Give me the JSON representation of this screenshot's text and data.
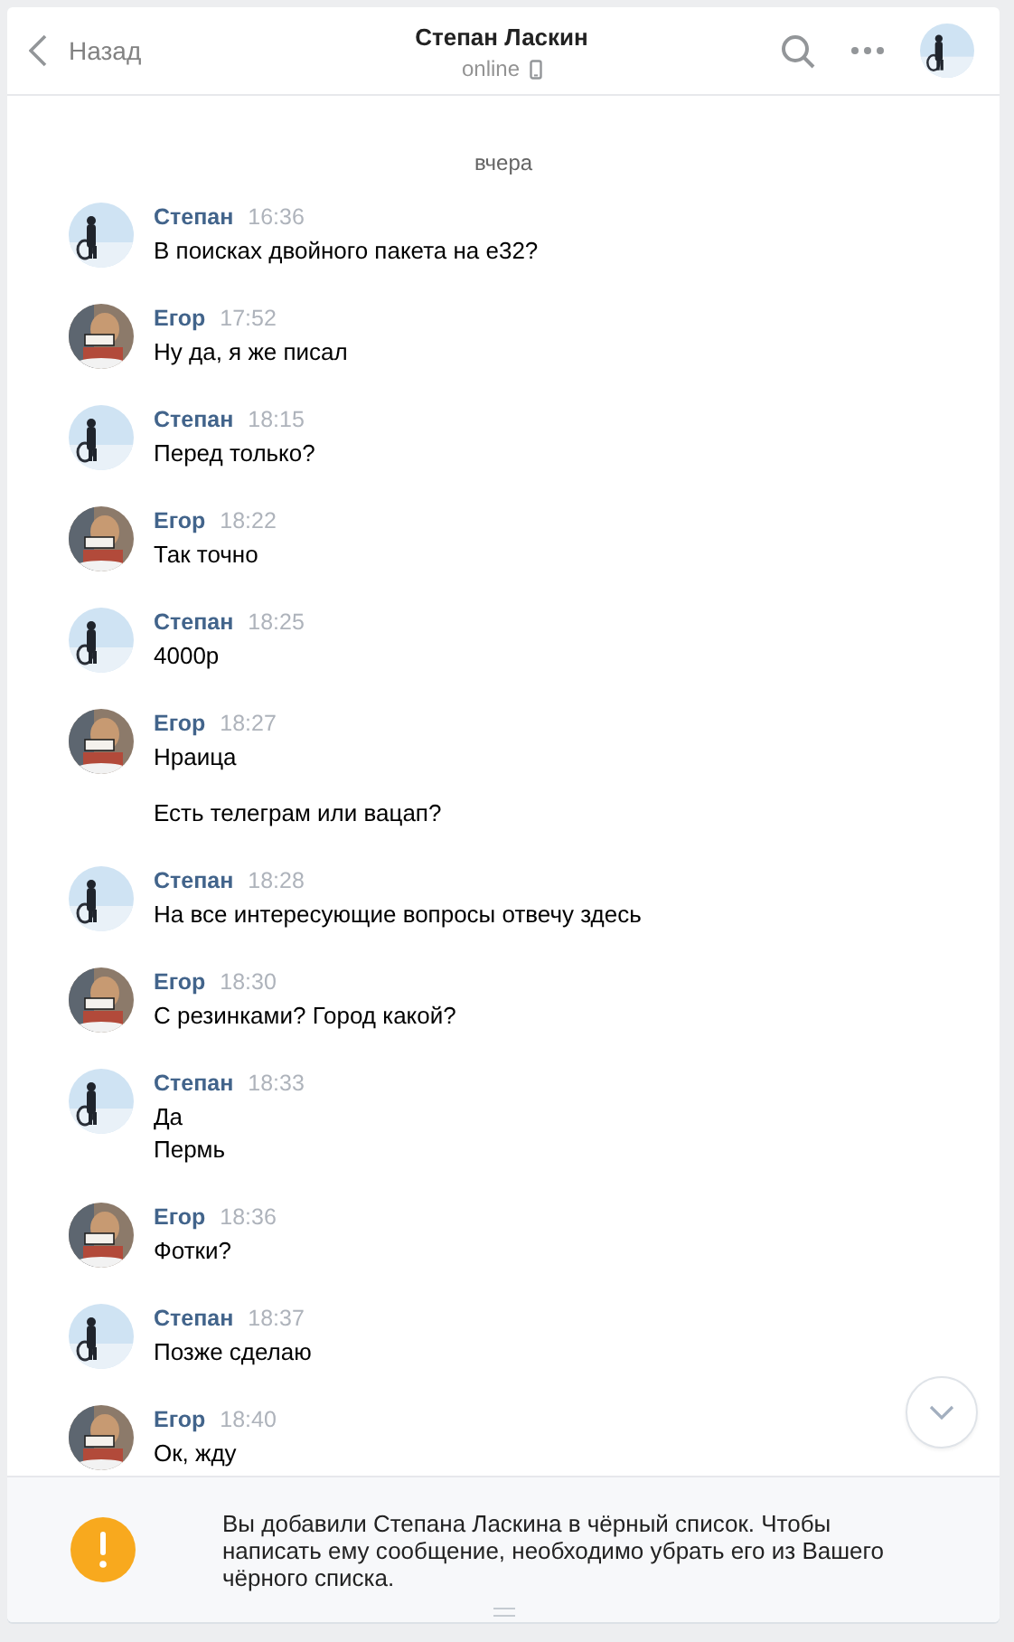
{
  "header": {
    "back_label": "Назад",
    "title": "Степан Ласкин",
    "status": "online"
  },
  "date_divider": "вчера",
  "messages": [
    {
      "author": "Степан",
      "time": "16:36",
      "messages": [
        {
          "lines": [
            "В поисках двойного пакета на е32?"
          ]
        }
      ]
    },
    {
      "author": "Егор",
      "time": "17:52",
      "messages": [
        {
          "lines": [
            "Ну да, я же писал"
          ]
        }
      ]
    },
    {
      "author": "Степан",
      "time": "18:15",
      "messages": [
        {
          "lines": [
            "Перед только?"
          ]
        }
      ]
    },
    {
      "author": "Егор",
      "time": "18:22",
      "messages": [
        {
          "lines": [
            "Так точно"
          ]
        }
      ]
    },
    {
      "author": "Степан",
      "time": "18:25",
      "messages": [
        {
          "lines": [
            "4000р"
          ]
        }
      ]
    },
    {
      "author": "Егор",
      "time": "18:27",
      "messages": [
        {
          "lines": [
            "Нраица"
          ]
        },
        {
          "lines": [
            "Есть телеграм или вацап?"
          ]
        }
      ]
    },
    {
      "author": "Степан",
      "time": "18:28",
      "messages": [
        {
          "lines": [
            "На все интересующие вопросы отвечу здесь"
          ]
        }
      ]
    },
    {
      "author": "Егор",
      "time": "18:30",
      "messages": [
        {
          "lines": [
            "С резинками? Город какой?"
          ]
        }
      ]
    },
    {
      "author": "Степан",
      "time": "18:33",
      "messages": [
        {
          "lines": [
            "Да",
            "Пермь"
          ]
        }
      ]
    },
    {
      "author": "Егор",
      "time": "18:36",
      "messages": [
        {
          "lines": [
            "Фотки?"
          ]
        }
      ]
    },
    {
      "author": "Степан",
      "time": "18:37",
      "messages": [
        {
          "lines": [
            "Позже сделаю"
          ]
        }
      ]
    },
    {
      "author": "Егор",
      "time": "18:40",
      "messages": [
        {
          "lines": [
            "Ок, жду"
          ]
        }
      ]
    }
  ],
  "blocked_notice": "Вы добавили Степана Ласкина в чёрный список. Чтобы написать ему сообщение, необходимо убрать его из Вашего чёрного списка."
}
